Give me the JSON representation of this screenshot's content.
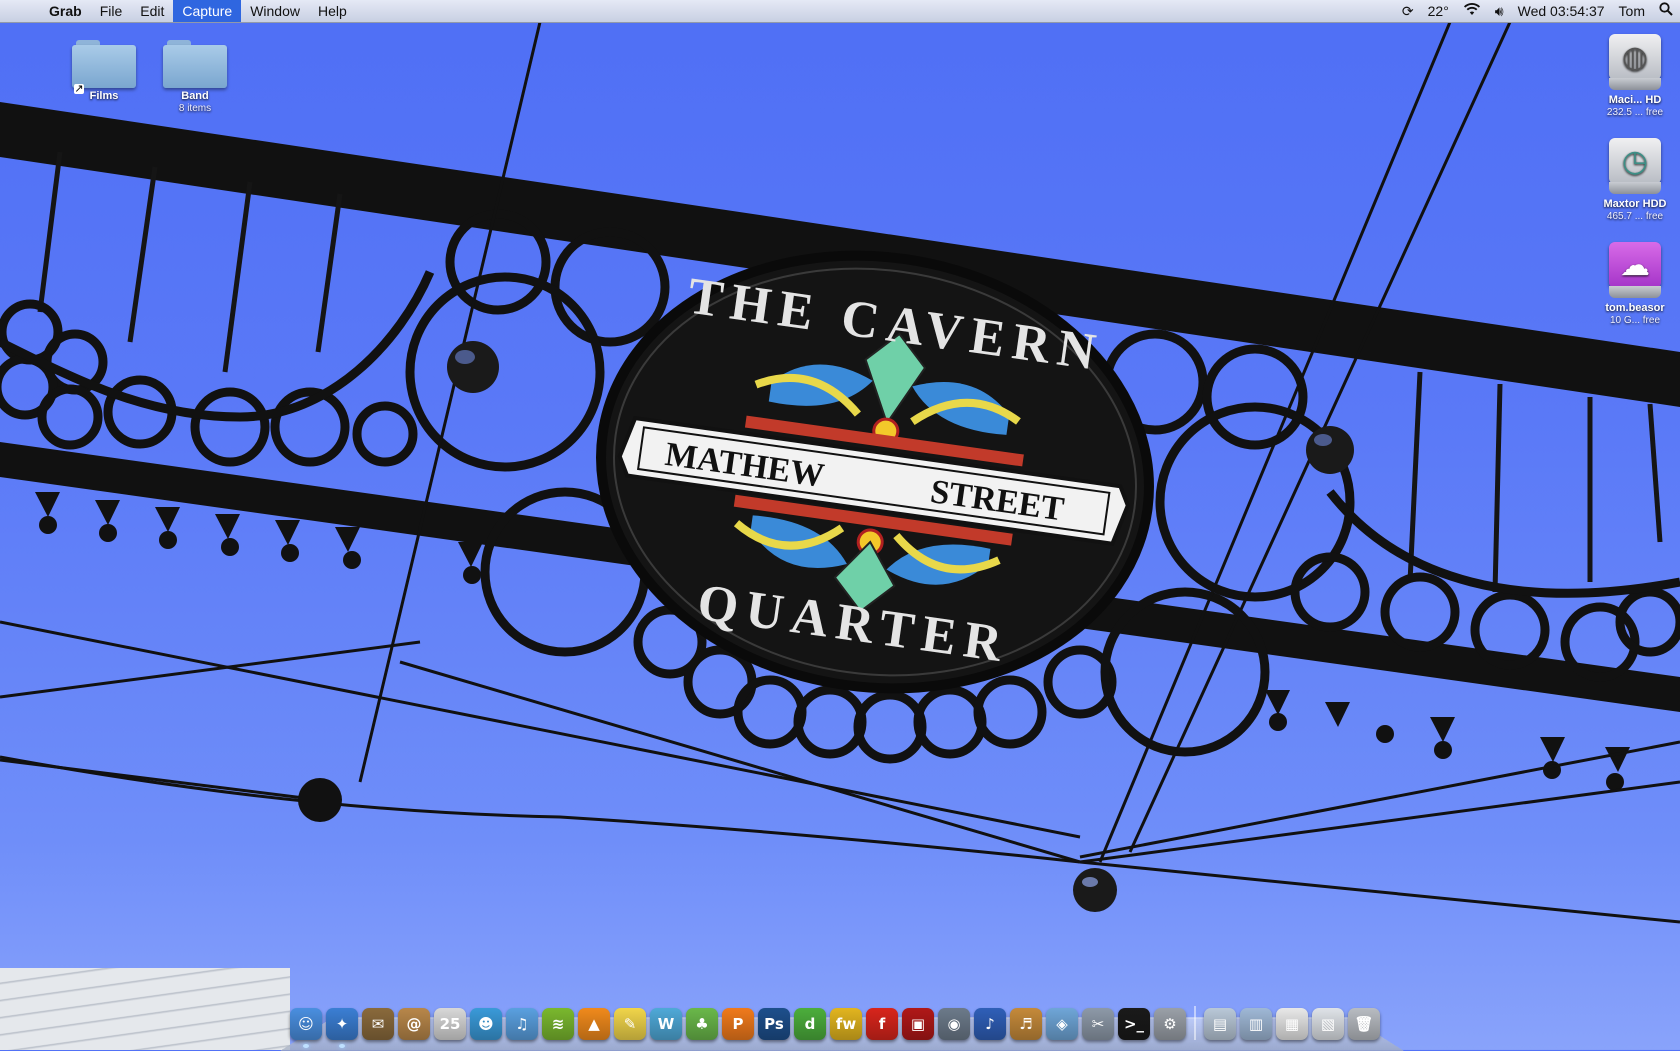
{
  "menubar": {
    "apple_symbol": "",
    "app_name": "Grab",
    "menus": [
      "File",
      "Edit",
      "Capture",
      "Window",
      "Help"
    ],
    "active_menu": "Capture",
    "status": {
      "sync_icon": "sync-icon",
      "temperature": "22°",
      "wifi_icon": "wifi-icon",
      "volume_icon": "volume-icon",
      "clock": "Wed 03:54:37",
      "user": "Tom",
      "spotlight_icon": "spotlight-icon"
    }
  },
  "desktop": {
    "left_icons": [
      {
        "name": "Films",
        "sub": "",
        "type": "folder-alias"
      },
      {
        "name": "Band",
        "sub": "8 items",
        "type": "folder"
      }
    ],
    "right_icons": [
      {
        "name": "Maci... HD",
        "sub": "232.5 ... free",
        "type": "hard-disk"
      },
      {
        "name": "Maxtor HDD",
        "sub": "465.7 ... free",
        "type": "time-machine-disk"
      },
      {
        "name": "tom.beasor",
        "sub": "10 G... free",
        "type": "cloud-disk"
      }
    ],
    "wallpaper": {
      "sign_top": "THE CAVERN",
      "sign_banner_left": "MATHEW",
      "sign_banner_right": "STREET",
      "sign_bottom": "QUARTER",
      "sky_color": "#5a79f7"
    }
  },
  "dock": {
    "items": [
      {
        "name": "finder",
        "glyph": "☺",
        "color": "#4a8fe0"
      },
      {
        "name": "safari",
        "glyph": "✦",
        "color": "#3b7fd4"
      },
      {
        "name": "mail",
        "glyph": "✉",
        "color": "#8a6a3c"
      },
      {
        "name": "address-book",
        "glyph": "@",
        "color": "#b8874a"
      },
      {
        "name": "ical",
        "glyph": "25",
        "color": "#d8d8d8"
      },
      {
        "name": "ichat",
        "glyph": "☻",
        "color": "#3a9ad9"
      },
      {
        "name": "itunes",
        "glyph": "♫",
        "color": "#5aa0e0"
      },
      {
        "name": "spotify",
        "glyph": "≋",
        "color": "#7ab82e"
      },
      {
        "name": "vlc",
        "glyph": "▲",
        "color": "#f08a1c"
      },
      {
        "name": "stickies",
        "glyph": "✎",
        "color": "#f1d54a"
      },
      {
        "name": "dreamweaver",
        "glyph": "W",
        "color": "#4fa9d8"
      },
      {
        "name": "fireworks",
        "glyph": "♣",
        "color": "#6ab84a"
      },
      {
        "name": "illustrator",
        "glyph": "P",
        "color": "#f07a1c"
      },
      {
        "name": "photoshop",
        "glyph": "Ps",
        "color": "#1d4f8c"
      },
      {
        "name": "dreamweaver-cs",
        "glyph": "d",
        "color": "#4cae3c"
      },
      {
        "name": "flash-player",
        "glyph": "fw",
        "color": "#e2b51f"
      },
      {
        "name": "flash",
        "glyph": "f",
        "color": "#d8251c"
      },
      {
        "name": "photo-booth",
        "glyph": "▣",
        "color": "#b01818"
      },
      {
        "name": "iphoto",
        "glyph": "◉",
        "color": "#6c7a8a"
      },
      {
        "name": "audio-hijack",
        "glyph": "♪",
        "color": "#2f5fb8"
      },
      {
        "name": "garageband",
        "glyph": "♬",
        "color": "#c58a3a"
      },
      {
        "name": "virtualbox",
        "glyph": "◈",
        "color": "#6fa6d8"
      },
      {
        "name": "system-tools",
        "glyph": "✂",
        "color": "#8d99a8"
      },
      {
        "name": "terminal",
        "glyph": ">_",
        "color": "#1a1a1a"
      },
      {
        "name": "system-preferences",
        "glyph": "⚙",
        "color": "#9aa0a8"
      }
    ],
    "stack_items": [
      {
        "name": "applications-stack",
        "glyph": "▤",
        "color": "#b9c8d8"
      },
      {
        "name": "documents-stack",
        "glyph": "▥",
        "color": "#9fb8d6"
      },
      {
        "name": "downloads-stack",
        "glyph": "▦",
        "color": "#e8e8e8"
      },
      {
        "name": "finder-window-stack",
        "glyph": "▧",
        "color": "#dfe3e8"
      },
      {
        "name": "trash",
        "glyph": "🗑",
        "color": "#b8bcc2"
      }
    ]
  }
}
